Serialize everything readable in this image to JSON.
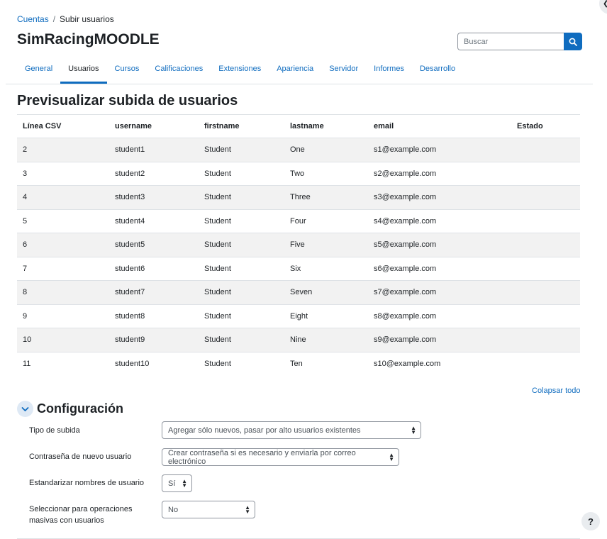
{
  "breadcrumb": {
    "items": [
      "Cuentas",
      "Subir usuarios"
    ],
    "separator": "/"
  },
  "site": {
    "title": "SimRacingMOODLE"
  },
  "search": {
    "placeholder": "Buscar",
    "icon": "search-icon"
  },
  "tabs": [
    "General",
    "Usuarios",
    "Cursos",
    "Calificaciones",
    "Extensiones",
    "Apariencia",
    "Servidor",
    "Informes",
    "Desarrollo"
  ],
  "active_tab": "Usuarios",
  "page": {
    "heading": "Previsualizar subida de usuarios"
  },
  "table": {
    "headers": [
      "Línea CSV",
      "username",
      "firstname",
      "lastname",
      "email",
      "Estado"
    ],
    "rows": [
      [
        "2",
        "student1",
        "Student",
        "One",
        "s1@example.com",
        ""
      ],
      [
        "3",
        "student2",
        "Student",
        "Two",
        "s2@example.com",
        ""
      ],
      [
        "4",
        "student3",
        "Student",
        "Three",
        "s3@example.com",
        ""
      ],
      [
        "5",
        "student4",
        "Student",
        "Four",
        "s4@example.com",
        ""
      ],
      [
        "6",
        "student5",
        "Student",
        "Five",
        "s5@example.com",
        ""
      ],
      [
        "7",
        "student6",
        "Student",
        "Six",
        "s6@example.com",
        ""
      ],
      [
        "8",
        "student7",
        "Student",
        "Seven",
        "s7@example.com",
        ""
      ],
      [
        "9",
        "student8",
        "Student",
        "Eight",
        "s8@example.com",
        ""
      ],
      [
        "10",
        "student9",
        "Student",
        "Nine",
        "s9@example.com",
        ""
      ],
      [
        "11",
        "student10",
        "Student",
        "Ten",
        "s10@example.com",
        ""
      ]
    ]
  },
  "config": {
    "collapse_all": "Colapsar todo",
    "heading": "Configuración",
    "fields": {
      "upload_type": {
        "label": "Tipo de subida",
        "value": "Agregar sólo nuevos, pasar por alto usuarios existentes"
      },
      "new_password": {
        "label": "Contraseña de nuevo usuario",
        "value": "Crear contraseña si es necesario y enviarla por correo electrónico"
      },
      "standardise": {
        "label": "Estandarizar nombres de usuario",
        "value": "Sí"
      },
      "bulk": {
        "label": "Seleccionar para operaciones masivas con usuarios",
        "value": "No"
      }
    }
  },
  "help": {
    "label": "?"
  },
  "colors": {
    "accent": "#0f6cbf",
    "text": "#1d2125",
    "stripe": "#f2f2f2",
    "border": "#dee2e6"
  }
}
